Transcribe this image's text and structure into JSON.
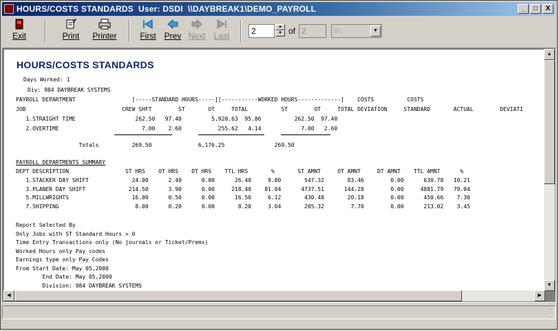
{
  "window": {
    "title": "HOURS/COSTS STANDARDS  User: DSDI  \\\\DAYBREAK1\\DEMO_PAYROLL",
    "minimize": "_",
    "maximize": "□",
    "close": "X"
  },
  "toolbar": {
    "exit": "Exit",
    "print": "Print",
    "printer": "Printer",
    "first": "First",
    "prev": "Prev",
    "next": "Next",
    "last": "Last",
    "page_current": "2",
    "of_label": "of",
    "page_total": "2",
    "zoom": "80"
  },
  "report": {
    "title": "HOURS/COSTS STANDARDS",
    "days_worked": "Days Worked: 1",
    "div": "Div: 984 DAYBREAK SYSTEMS",
    "hdr1": "PAYROLL DEPARTMENT                 [-----STANDARD HOURS-----][-----------WORKED HOURS-------------]    COSTS          COSTS",
    "hdr2": "JOB                             CREW SHFT        ST       OT     TOTAL          ST        OT     TOTAL DEVIATION     STANDARD       ACTUAL        DEVIATI",
    "rows": [
      "   1.STRAIGHT TIME                  262.50   97.40         5,920.63  95.86          262.50  97.40",
      "   2.OVERTIME                         7.00    2.60           255.62   4.14            7.00   2.60"
    ],
    "totals": "                   Totals          269.50              6,176.25               269.50",
    "summary_title": "PAYROLL DEPARTMENTS SUMMARY",
    "sum_hdr": "DEPT DESCRIPTION                 ST HRS    OT HRS    DT HRS    TTL HRS       %       ST AMNT     OT AMNT     DT AMNT    TTL AMNT      %",
    "sum_rows": [
      "   1.STACKER DAY SHIFT             24.00      2.40      0.00      26.40     9.80       547.32       83.46        0.00      630.78   10.21",
      "   3.PLANER DAY SHIFT             214.50      3.90      0.00     218.40    81.04      4737.51      144.28        0.00     4881.79   79.04",
      "   5.MILLWRIGHTS                   16.00      0.50      0.00      16.50     6.12       430.48       20.18        0.00      450.66    7.30",
      "   7.SHIPPING                       8.00      0.20      0.00       8.20     3.04       205.32        7.70        0.00      213.02    3.45"
    ],
    "footer": [
      "Report Selected By",
      "Only Jobs with ST Standard Hours > 0",
      "Time Entry Transactions only (No journals or Ticket/Prems)",
      "Worked Hours only Pay codes",
      "Earnings type only Pay Codes",
      "From Start Date: May 05,2000",
      "        End Date: May 05,2000",
      "        Division: 984 DAYBREAK SYSTEMS"
    ]
  }
}
